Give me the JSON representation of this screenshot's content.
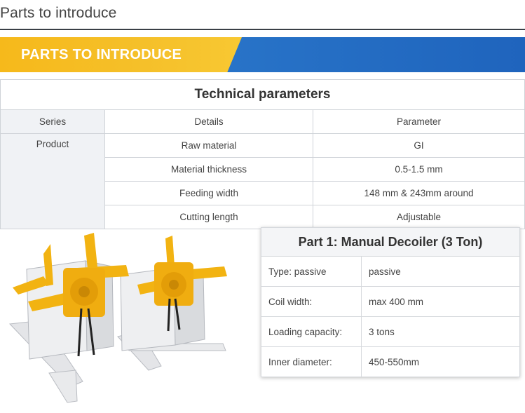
{
  "page": {
    "heading": "Parts to introduce"
  },
  "banner": {
    "title": "PARTS TO INTRODUCE",
    "colors": {
      "yellow": "#f6b91b",
      "blue": "#1f64bd"
    }
  },
  "tech_table": {
    "title": "Technical parameters",
    "headers": [
      "Series",
      "Details",
      "Parameter"
    ],
    "series_value": "Product",
    "rows": [
      {
        "detail": "Raw material",
        "parameter": "GI"
      },
      {
        "detail": "Material thickness",
        "parameter": "0.5-1.5 mm"
      },
      {
        "detail": "Feeding width",
        "parameter": "148 mm & 243mm around"
      },
      {
        "detail": "Cutting length",
        "parameter": "Adjustable"
      }
    ]
  },
  "part1": {
    "title": "Part 1: Manual Decoiler (3 Ton)",
    "rows": [
      {
        "key": "Type: passive",
        "value": "passive"
      },
      {
        "key": "Coil width:",
        "value": "max 400 mm"
      },
      {
        "key": "Loading capacity:",
        "value": "3 tons"
      },
      {
        "key": "Inner diameter:",
        "value": "450-550mm"
      }
    ]
  },
  "image": {
    "subject": "manual-decoiler-photo",
    "colors": {
      "arms": "#f2b312",
      "frame": "#e9eaec"
    }
  }
}
